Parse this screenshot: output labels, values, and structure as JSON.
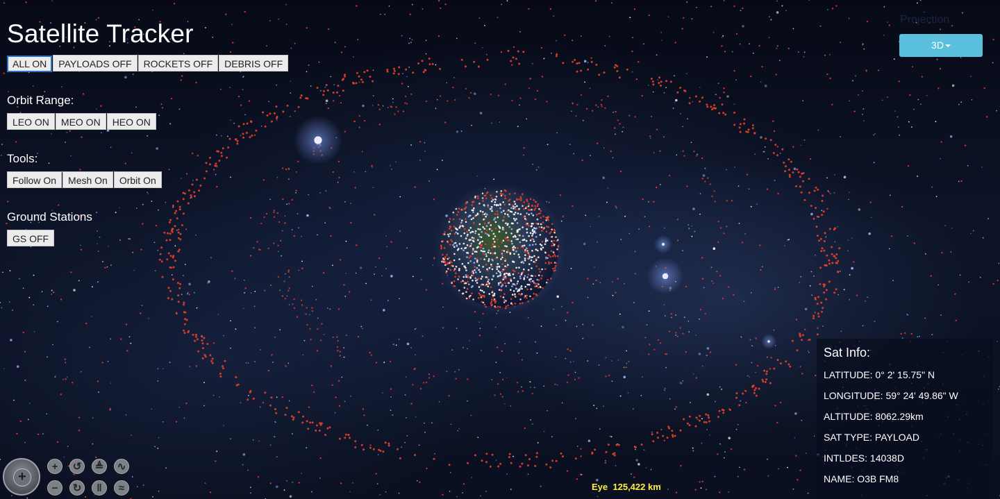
{
  "app": {
    "title": "Satellite Tracker"
  },
  "filters": {
    "all": "ALL ON",
    "payloads": "PAYLOADS OFF",
    "rockets": "ROCKETS OFF",
    "debris": "DEBRIS OFF"
  },
  "orbit_range": {
    "label": "Orbit Range:",
    "leo": "LEO ON",
    "meo": "MEO ON",
    "heo": "HEO ON"
  },
  "tools": {
    "label": "Tools:",
    "follow": "Follow On",
    "mesh": "Mesh On",
    "orbit": "Orbit On"
  },
  "ground_stations": {
    "label": "Ground Stations",
    "gs": "GS OFF"
  },
  "projection": {
    "label": "Projection",
    "value": "3D"
  },
  "sat_info": {
    "title": "Sat Info:",
    "latitude": "LATITUDE: 0° 2' 15.75\" N",
    "longitude": "LONGITUDE: 59° 24' 49.86\" W",
    "altitude": "ALTITUDE: 8062.29km",
    "sat_type": "SAT TYPE: PAYLOAD",
    "intldes": "INTLDES: 14038D",
    "name": "NAME: O3B FM8"
  },
  "eye": {
    "label": "Eye",
    "value": "125,422 km"
  },
  "colors": {
    "accent": "#5bc0de",
    "debris_dot": "#e8402a",
    "payload_dot": "#9fb7ff",
    "eye_text": "#ffef3a"
  },
  "icons": {
    "compass": "compass-icon",
    "zoom_in": "zoom-in-icon",
    "zoom_out": "zoom-out-icon",
    "rotate_left": "rotate-left-icon",
    "rotate_right": "rotate-right-icon",
    "tilt_up": "tilt-up-icon",
    "tilt_down": "tilt-down-icon",
    "terrain": "terrain-icon",
    "water": "water-icon"
  }
}
